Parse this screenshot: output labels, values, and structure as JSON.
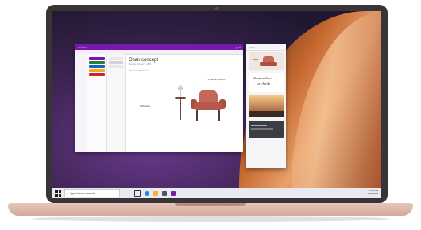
{
  "onenote": {
    "app_title": "OneNote",
    "page_title": "Chair concept",
    "page_date": "Monday, October 5, 2020",
    "note_line": "Chair and ottoman set",
    "hand_1": "Leather fabric",
    "hand_2": "Ottoman",
    "sections": [
      "#7719aa",
      "#2e7d32",
      "#1565c0",
      "#f9a825",
      "#c62828"
    ]
  },
  "panel": {
    "title": "Notes",
    "card_hand_1": "Remember",
    "card_hand_2": "to check"
  },
  "taskbar": {
    "search_placeholder": "Type here to search",
    "time": "10:14 AM",
    "date": "10/5/2020"
  }
}
